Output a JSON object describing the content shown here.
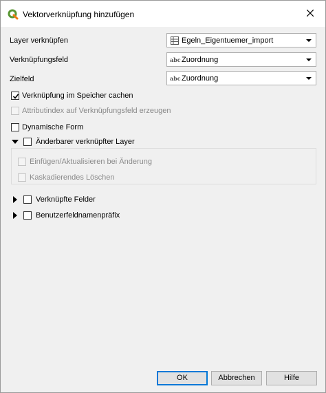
{
  "dialog": {
    "title": "Vektorverknüpfung hinzufügen",
    "close_icon": "close-icon"
  },
  "fields": {
    "layer_label": "Layer verknüpfen",
    "layer_value": "Egeln_Eigentuemer_import",
    "join_field_label": "Verknüpfungsfeld",
    "join_field_value": "Zuordnung",
    "target_field_label": "Zielfeld",
    "target_field_value": "Zuordnung",
    "field_type_badge": "abc"
  },
  "options": {
    "cache": {
      "label": "Verknüpfung im Speicher cachen",
      "checked": true
    },
    "attr_index": {
      "label": "Attributindex auf Verknüpfungsfeld erzeugen",
      "checked": false,
      "disabled": true
    },
    "dynamic_form": {
      "label": "Dynamische Form",
      "checked": false
    }
  },
  "editable_group": {
    "label": "Änderbarer verknüpfter Layer",
    "upsert": {
      "label": "Einfügen/Aktualisieren bei Änderung",
      "disabled": true
    },
    "cascade_delete": {
      "label": "Kaskadierendes Löschen",
      "disabled": true
    }
  },
  "joined_fields": {
    "label": "Verknüpfte Felder"
  },
  "prefix": {
    "label": "Benutzerfeldnamenpräfix"
  },
  "buttons": {
    "ok": "OK",
    "cancel": "Abbrechen",
    "help": "Hilfe"
  },
  "colors": {
    "accent": "#0078d7",
    "qgis_green": "#589632",
    "qgis_yellow": "#ee7913"
  }
}
